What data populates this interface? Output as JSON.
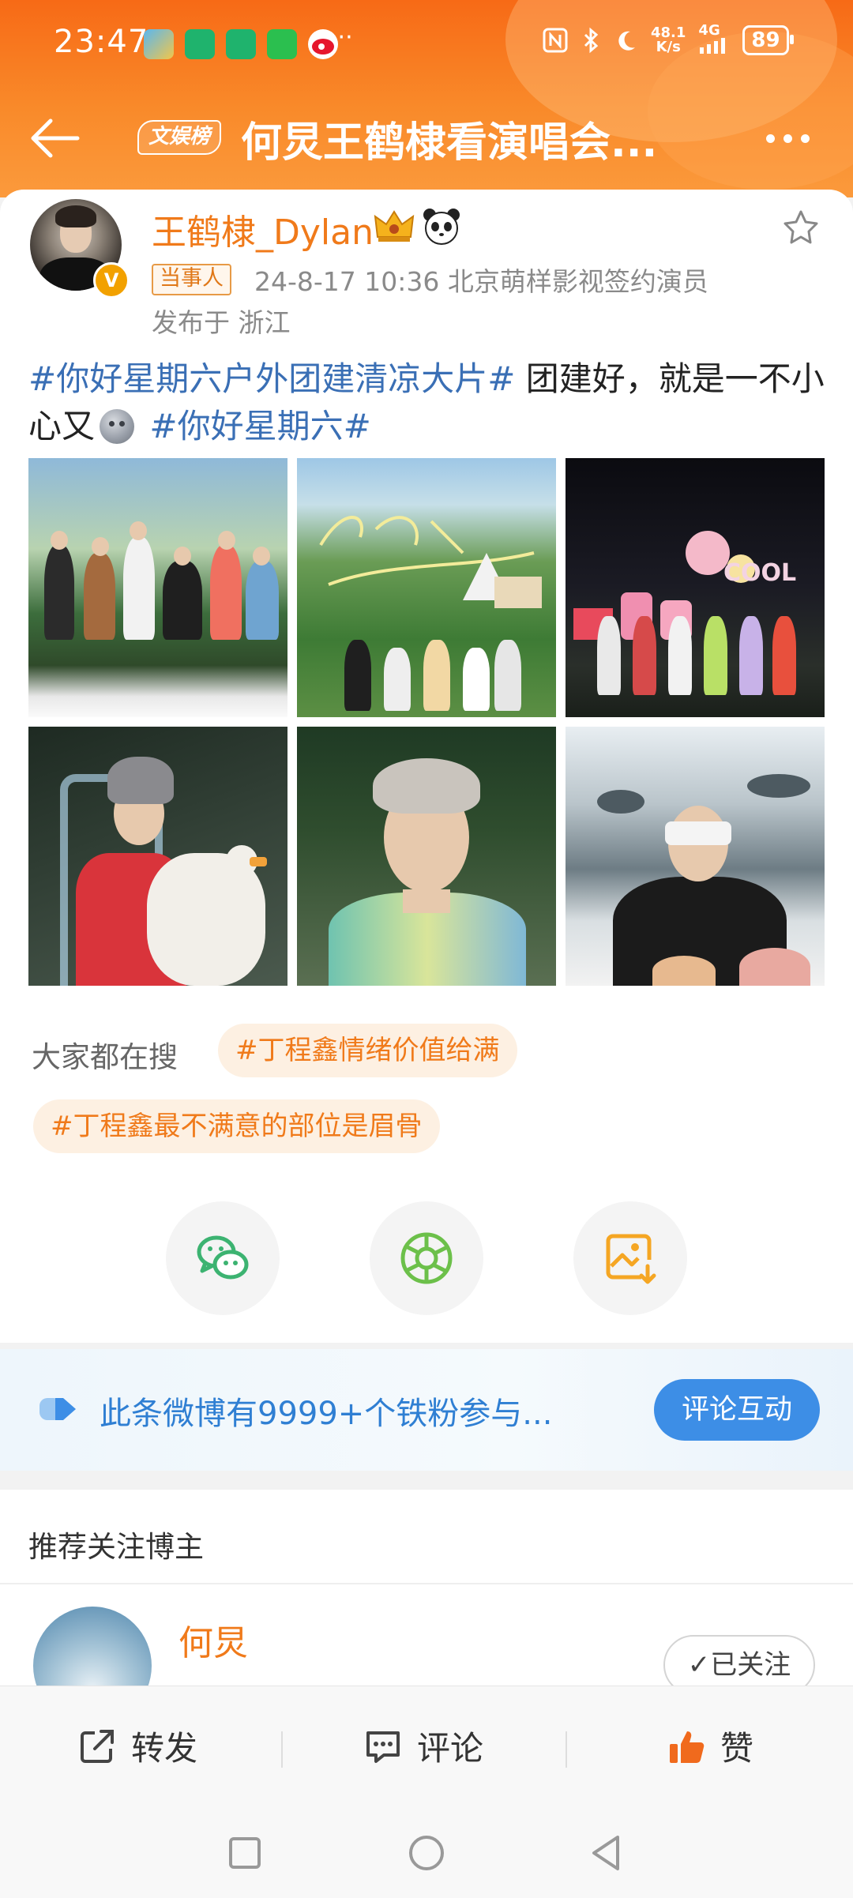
{
  "status_bar": {
    "time": "23:47",
    "dots": "···",
    "speed_value": "48.1",
    "speed_unit": "K/s",
    "network": "4G",
    "battery": "89"
  },
  "header": {
    "tag": "文娱榜",
    "title": "何炅王鹤棣看演唱会..."
  },
  "post": {
    "username": "王鹤棣_Dylan",
    "verified_mark": "V",
    "party_badge": "当事人",
    "meta": "24-8-17 10:36  北京萌样影视签约演员",
    "location": "发布于 浙江",
    "topic1": "#你好星期六户外团建清凉大片#",
    "text1": " 团建好，就是一不小心又",
    "topic2": "#你好星期六#",
    "images_count": 6
  },
  "hot_search": {
    "label": "大家都在搜",
    "items": [
      "#丁程鑫情绪价值给满",
      "#丁程鑫最不满意的部位是眉骨"
    ]
  },
  "share": {
    "icons": [
      "wechat-icon",
      "moments-icon",
      "save-image-icon"
    ],
    "colors": {
      "wechat": "#3cb371",
      "moments": "#6cc04a",
      "save": "#f5a623"
    }
  },
  "fan_banner": {
    "text": "此条微博有9999+个铁粉参与...",
    "button": "评论互动"
  },
  "recommend": {
    "title": "推荐关注博主",
    "name": "何炅",
    "follow_label": "已关注"
  },
  "actions": {
    "repost": "转发",
    "comment": "评论",
    "like": "赞"
  },
  "colors": {
    "header": "#f76a16",
    "username": "#f07a1a",
    "topic": "#3a6fb5",
    "fan_text": "#2f7fd3",
    "button": "#3d8ee6"
  }
}
